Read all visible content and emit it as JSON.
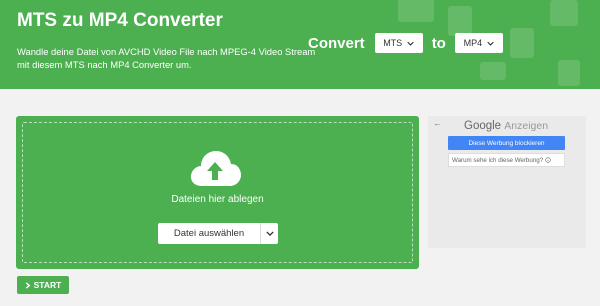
{
  "header": {
    "title": "MTS zu MP4 Converter",
    "description": "Wandle deine Datei von AVCHD Video File nach MPEG-4 Video Stream mit diesem MTS nach MP4 Converter um.",
    "background_color": "#4caf50",
    "decorative_icons": [
      "image-file-icon",
      "jpg-file-icon",
      "pdf-file-icon",
      "chart-icon",
      "document-icon",
      "mail-icon"
    ]
  },
  "converter": {
    "convert_label": "Convert",
    "from_format": "MTS",
    "to_label": "to",
    "to_format": "MP4"
  },
  "upload": {
    "drop_label": "Dateien hier ablegen",
    "choose_button": "Datei auswählen",
    "icon": "cloud-upload-icon"
  },
  "start_button": {
    "label": "START",
    "icon": "chevron-right-icon"
  },
  "ad": {
    "brand_google": "Google",
    "brand_ads": "Anzeigen",
    "block_button": "Diese Werbung blockieren",
    "why_link": "Warum sehe ich diese Werbung?",
    "why_icon": "info-icon"
  }
}
